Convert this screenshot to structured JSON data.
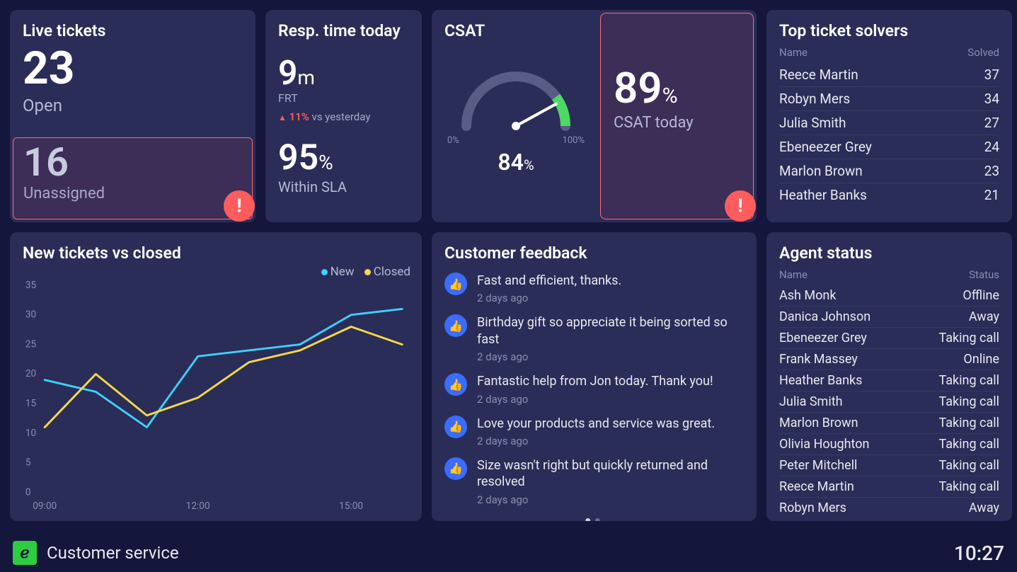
{
  "live_tickets": {
    "title": "Live tickets",
    "open_value": "23",
    "open_label": "Open",
    "unassigned_value": "16",
    "unassigned_label": "Unassigned"
  },
  "resp_time": {
    "title": "Resp. time today",
    "frt_value": "9",
    "frt_unit": "m",
    "frt_label": "FRT",
    "delta_pct": "11%",
    "delta_label": "vs yesterday",
    "sla_value": "95",
    "sla_unit": "%",
    "sla_label": "Within SLA"
  },
  "csat": {
    "title": "CSAT",
    "gauge_min": "0%",
    "gauge_max": "100%",
    "gauge_value": "84",
    "gauge_unit": "%",
    "today_value": "89",
    "today_unit": "%",
    "today_label": "CSAT today"
  },
  "solvers": {
    "title": "Top ticket solvers",
    "head_name": "Name",
    "head_solved": "Solved",
    "rows": [
      {
        "name": "Reece Martin",
        "solved": "37"
      },
      {
        "name": "Robyn Mers",
        "solved": "34"
      },
      {
        "name": "Julia Smith",
        "solved": "27"
      },
      {
        "name": "Ebeneezer Grey",
        "solved": "24"
      },
      {
        "name": "Marlon Brown",
        "solved": "23"
      },
      {
        "name": "Heather Banks",
        "solved": "21"
      }
    ]
  },
  "chart": {
    "title": "New tickets vs closed",
    "legend_new": "New",
    "legend_closed": "Closed"
  },
  "chart_data": {
    "type": "line",
    "x": [
      "09:00",
      "10:00",
      "11:00",
      "12:00",
      "13:00",
      "14:00",
      "15:00",
      "16:00"
    ],
    "x_labels_shown": [
      "09:00",
      "12:00",
      "15:00"
    ],
    "series": [
      {
        "name": "New",
        "color": "#3fcfff",
        "values": [
          19,
          17,
          11,
          23,
          24,
          25,
          30,
          31
        ]
      },
      {
        "name": "Closed",
        "color": "#f5d84a",
        "values": [
          11,
          20,
          13,
          16,
          22,
          24,
          28,
          25
        ]
      }
    ],
    "ylim": [
      0,
      35
    ],
    "yticks": [
      0,
      5,
      10,
      15,
      20,
      25,
      30,
      35
    ]
  },
  "feedback": {
    "title": "Customer feedback",
    "items": [
      {
        "text": "Fast and efficient, thanks.",
        "time": "2 days ago"
      },
      {
        "text": "Birthday gift so appreciate it being sorted so fast",
        "time": "2 days ago"
      },
      {
        "text": "Fantastic help from Jon today. Thank you!",
        "time": "2 days ago"
      },
      {
        "text": "Love your products and service was great.",
        "time": "2 days ago"
      },
      {
        "text": "Size wasn't right but quickly returned and resolved",
        "time": "2 days ago"
      }
    ]
  },
  "agents": {
    "title": "Agent status",
    "head_name": "Name",
    "head_status": "Status",
    "rows": [
      {
        "name": "Ash Monk",
        "status": "Offline"
      },
      {
        "name": "Danica Johnson",
        "status": "Away"
      },
      {
        "name": "Ebeneezer Grey",
        "status": "Taking call"
      },
      {
        "name": "Frank Massey",
        "status": "Online"
      },
      {
        "name": "Heather Banks",
        "status": "Taking call"
      },
      {
        "name": "Julia Smith",
        "status": "Taking call"
      },
      {
        "name": "Marlon Brown",
        "status": "Taking call"
      },
      {
        "name": "Olivia Houghton",
        "status": "Taking call"
      },
      {
        "name": "Peter Mitchell",
        "status": "Taking call"
      },
      {
        "name": "Reece Martin",
        "status": "Taking call"
      },
      {
        "name": "Robyn Mers",
        "status": "Away"
      }
    ]
  },
  "footer": {
    "title": "Customer service",
    "time": "10:27"
  },
  "colors": {
    "new": "#3fcfff",
    "closed": "#f5d84a",
    "alert": "#ff5d5d",
    "gauge_track": "#595c85",
    "gauge_fill": "#4cd964"
  }
}
